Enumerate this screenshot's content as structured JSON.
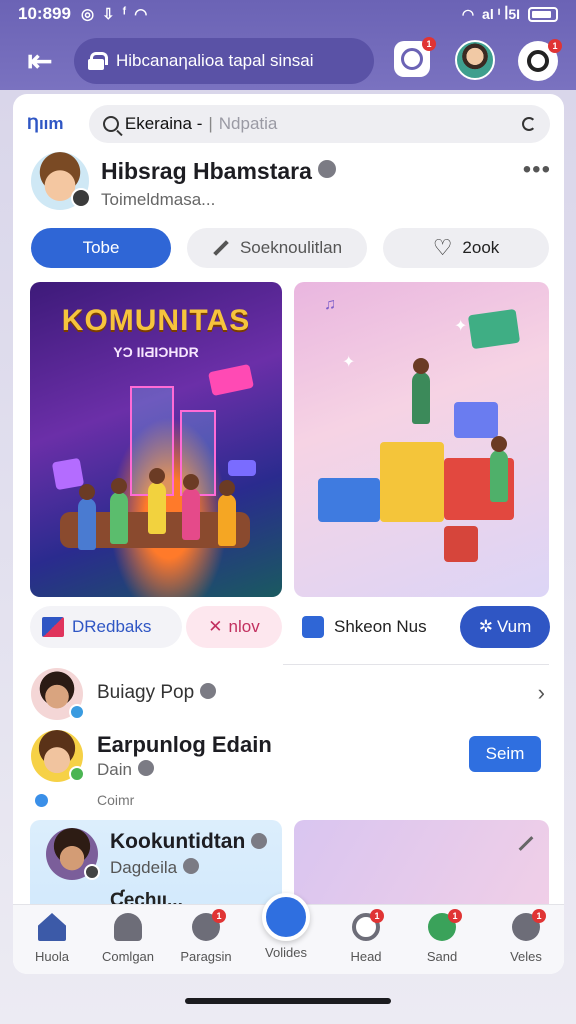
{
  "status_bar": {
    "time": "10:899",
    "icons": [
      "whatsapp-icon",
      "download-icon",
      "facebook-icon",
      "wifi-icon",
      "signal-icon",
      "battery-icon"
    ],
    "network": "al ᑊ ꟾ5Ι"
  },
  "top_bar": {
    "url": "Hibcanaƞalioa tapal sinsai",
    "camera_badge": "1",
    "settings_badge": "1"
  },
  "search": {
    "brand": "Ƞıım",
    "query": "Ekeraina -",
    "placeholder": "Ndpatia",
    "clear_icon": "C"
  },
  "profile": {
    "name": "Hibsrag Hbamstara",
    "subtitle": "Toimeldmasa...",
    "more": "•••"
  },
  "actions": {
    "primary": "Tobe",
    "secondary": "Soeknoulitlan",
    "like": "2ook"
  },
  "tiles": {
    "left_title": "KOMUNITAS",
    "left_subtitle": "YƆ IIƋIƆHDR"
  },
  "chips": {
    "chip1": "DRedbaks",
    "chip2": "nlov",
    "chip2_icon": "✕",
    "chip3": "Shkeon Nus",
    "chip4": "Vum",
    "chip4_icon": "✲"
  },
  "list": {
    "row1_title": "Buiagy Pop",
    "row2_title": "Earpunlog Edain",
    "row2_sub": "Dain",
    "row2_button": "Seim",
    "row3_label": "Coimr"
  },
  "bottom_tiles": {
    "title": "Kookuntidtan",
    "sub": "Dagdeila",
    "title2": "Ƈechıı..."
  },
  "nav": {
    "items": [
      {
        "label": "Huola",
        "icon": "home-icon"
      },
      {
        "label": "Comlgan",
        "icon": "people-icon"
      },
      {
        "label": "Paragsin",
        "icon": "search-icon",
        "badge": "1"
      },
      {
        "label": "Volides",
        "icon": "video-icon"
      },
      {
        "label": "Head",
        "icon": "chat-icon",
        "badge": "1"
      },
      {
        "label": "Sand",
        "icon": "bell-icon",
        "badge": "1"
      },
      {
        "label": "Veles",
        "icon": "menu-icon",
        "badge": "1"
      }
    ]
  },
  "colors": {
    "accent": "#2f66d6",
    "header": "#6b63b5",
    "badge": "#e03434"
  }
}
